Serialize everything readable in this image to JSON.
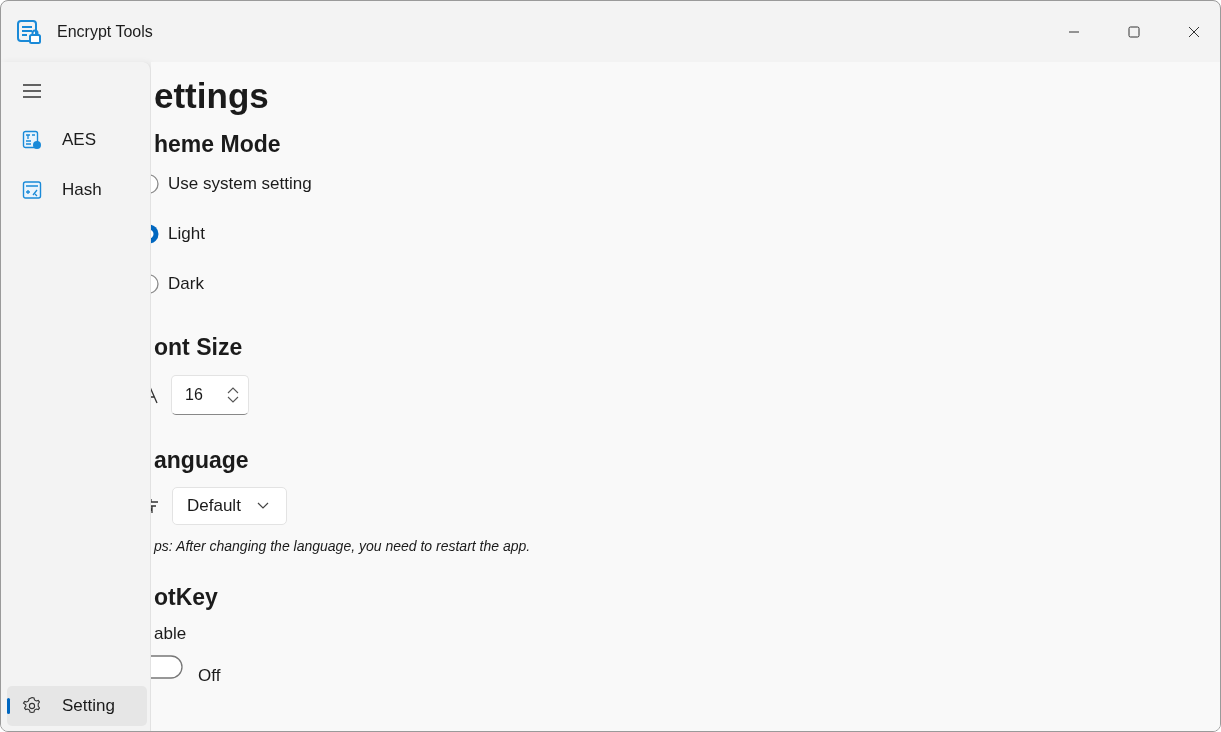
{
  "window": {
    "title": "Encrypt Tools"
  },
  "nav": {
    "items": [
      {
        "label": "AES",
        "selected": false
      },
      {
        "label": "Hash",
        "selected": false
      }
    ],
    "footer_items": [
      {
        "label": "Setting",
        "selected": true
      }
    ]
  },
  "page": {
    "title": "ettings",
    "theme": {
      "heading": "heme Mode",
      "options": [
        {
          "label": "Use system setting",
          "selected": false
        },
        {
          "label": "Light",
          "selected": true
        },
        {
          "label": "Dark",
          "selected": false
        }
      ]
    },
    "font_size": {
      "heading": "ont Size",
      "value": "16"
    },
    "language": {
      "heading": "anguage",
      "value": "Default",
      "tip": "ps: After changing the language, you need to restart the app."
    },
    "hotkey": {
      "heading": "otKey",
      "label": "able",
      "toggle": {
        "on": false,
        "text": "Off"
      }
    }
  }
}
